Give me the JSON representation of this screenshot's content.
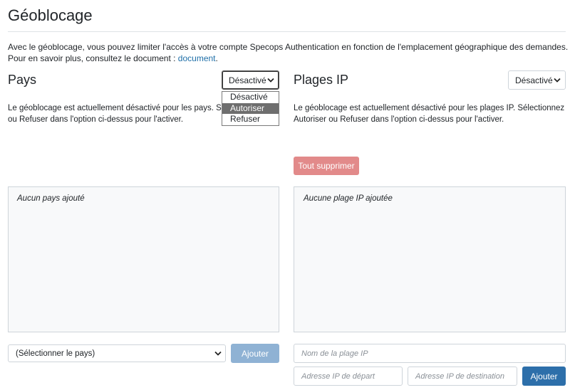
{
  "page": {
    "title": "Géoblocage",
    "intro_line1": "Avec le géoblocage, vous pouvez limiter l'accès à votre compte Specops Authentication en fonction de l'emplacement géographique des demandes.",
    "intro_line2_prefix": "Pour en savoir plus, consultez le document : ",
    "intro_link": "document",
    "intro_line2_suffix": "."
  },
  "countries": {
    "title": "Pays",
    "mode_selected": "Désactivé",
    "mode_options": [
      "Désactivé",
      "Autoriser",
      "Refuser"
    ],
    "mode_highlighted": "Autoriser",
    "note_line1": "Le géoblocage est actuellement désactivé pour les pays. Sélectionnez",
    "note_line2": "ou Refuser dans l'option ci-dessus pour l'activer.",
    "empty_text": "Aucun pays ajouté",
    "country_select_value": "(Sélectionner le pays)",
    "add_label": "Ajouter"
  },
  "ip_ranges": {
    "title": "Plages IP",
    "mode_selected": "Désactivé",
    "note_line1": "Le géoblocage est actuellement désactivé pour les plages IP. Sélectionnez",
    "note_line2": "Autoriser ou Refuser dans l'option ci-dessus pour l'activer.",
    "delete_all_label": "Tout supprimer",
    "empty_text": "Aucune plage IP ajoutée",
    "name_placeholder": "Nom de la plage IP",
    "start_placeholder": "Adresse IP de départ",
    "end_placeholder": "Adresse IP de destination",
    "add_label": "Ajouter"
  },
  "colors": {
    "link": "#1f6fa8",
    "danger_light": "#e28a8a",
    "primary": "#2d6faa",
    "primary_disabled": "#8fb2d4",
    "panel_bg": "#f8f9fa",
    "border": "#ced4da"
  },
  "icons": {
    "select_chevron": "chevron-down-icon"
  }
}
